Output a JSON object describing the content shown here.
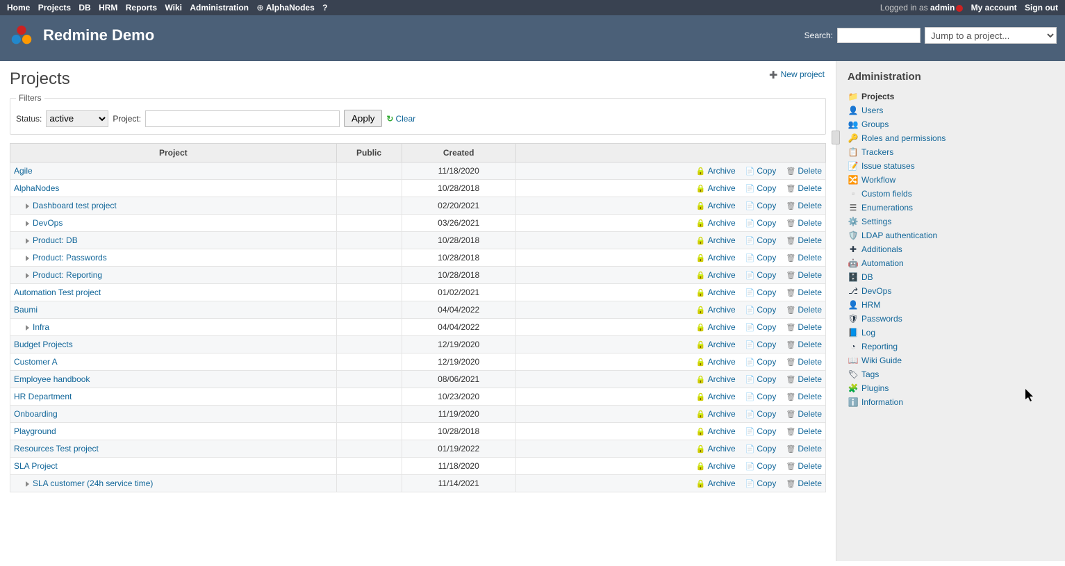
{
  "topmenu": {
    "home": "Home",
    "projects": "Projects",
    "db": "DB",
    "hrm": "HRM",
    "reports": "Reports",
    "wiki": "Wiki",
    "admin": "Administration",
    "alphanodes": "AlphaNodes",
    "help": "?",
    "logged_prefix": "Logged in as ",
    "user": "admin",
    "myaccount": "My account",
    "signout": "Sign out"
  },
  "header": {
    "title": "Redmine Demo",
    "search_label": "Search:",
    "jump_placeholder": "Jump to a project..."
  },
  "page": {
    "title": "Projects",
    "new_project": "New project"
  },
  "filters": {
    "legend": "Filters",
    "status_label": "Status:",
    "status_value": "active",
    "project_label": "Project:",
    "project_value": "",
    "apply": "Apply",
    "clear": "Clear"
  },
  "table": {
    "headers": {
      "project": "Project",
      "public": "Public",
      "created": "Created"
    },
    "actions": {
      "archive": "Archive",
      "copy": "Copy",
      "delete": "Delete"
    },
    "rows": [
      {
        "name": "Agile",
        "created": "11/18/2020",
        "indent": 0,
        "expander": false
      },
      {
        "name": "AlphaNodes",
        "created": "10/28/2018",
        "indent": 0,
        "expander": false
      },
      {
        "name": "Dashboard test project",
        "created": "02/20/2021",
        "indent": 1,
        "expander": true
      },
      {
        "name": "DevOps",
        "created": "03/26/2021",
        "indent": 1,
        "expander": true
      },
      {
        "name": "Product: DB",
        "created": "10/28/2018",
        "indent": 1,
        "expander": true
      },
      {
        "name": "Product: Passwords",
        "created": "10/28/2018",
        "indent": 1,
        "expander": true
      },
      {
        "name": "Product: Reporting",
        "created": "10/28/2018",
        "indent": 1,
        "expander": true
      },
      {
        "name": "Automation Test project",
        "created": "01/02/2021",
        "indent": 0,
        "expander": false
      },
      {
        "name": "Baumi",
        "created": "04/04/2022",
        "indent": 0,
        "expander": false
      },
      {
        "name": "Infra",
        "created": "04/04/2022",
        "indent": 1,
        "expander": true
      },
      {
        "name": "Budget Projects",
        "created": "12/19/2020",
        "indent": 0,
        "expander": false
      },
      {
        "name": "Customer A",
        "created": "12/19/2020",
        "indent": 0,
        "expander": false
      },
      {
        "name": "Employee handbook",
        "created": "08/06/2021",
        "indent": 0,
        "expander": false
      },
      {
        "name": "HR Department",
        "created": "10/23/2020",
        "indent": 0,
        "expander": false
      },
      {
        "name": "Onboarding",
        "created": "11/19/2020",
        "indent": 0,
        "expander": false
      },
      {
        "name": "Playground",
        "created": "10/28/2018",
        "indent": 0,
        "expander": false
      },
      {
        "name": "Resources Test project",
        "created": "01/19/2022",
        "indent": 0,
        "expander": false
      },
      {
        "name": "SLA Project",
        "created": "11/18/2020",
        "indent": 0,
        "expander": false
      },
      {
        "name": "SLA customer (24h service time)",
        "created": "11/14/2021",
        "indent": 1,
        "expander": true
      }
    ]
  },
  "sidebar": {
    "title": "Administration",
    "items": [
      {
        "label": "Projects",
        "icon": "📁",
        "selected": true
      },
      {
        "label": "Users",
        "icon": "👤"
      },
      {
        "label": "Groups",
        "icon": "👥"
      },
      {
        "label": "Roles and permissions",
        "icon": "🔑"
      },
      {
        "label": "Trackers",
        "icon": "📋"
      },
      {
        "label": "Issue statuses",
        "icon": "📝"
      },
      {
        "label": "Workflow",
        "icon": "🔀"
      },
      {
        "label": "Custom fields",
        "icon": "▫️"
      },
      {
        "label": "Enumerations",
        "icon": "☰"
      },
      {
        "label": "Settings",
        "icon": "⚙️"
      },
      {
        "label": "LDAP authentication",
        "icon": "🛡️"
      },
      {
        "label": "Additionals",
        "icon": "✚",
        "dark": true
      },
      {
        "label": "Automation",
        "icon": "🤖",
        "dark": true
      },
      {
        "label": "DB",
        "icon": "🗄️",
        "dark": true
      },
      {
        "label": "DevOps",
        "icon": "⎇",
        "dark": true
      },
      {
        "label": "HRM",
        "icon": "👤",
        "dark": true
      },
      {
        "label": "Passwords",
        "icon": "🛡",
        "dark": true
      },
      {
        "label": "Log",
        "icon": "📘",
        "dark": true
      },
      {
        "label": "Reporting",
        "icon": "◔",
        "dark": true
      },
      {
        "label": "Wiki Guide",
        "icon": "📖",
        "dark": true
      },
      {
        "label": "Tags",
        "icon": "🏷",
        "dark": true
      },
      {
        "label": "Plugins",
        "icon": "🧩"
      },
      {
        "label": "Information",
        "icon": "ℹ️"
      }
    ]
  }
}
